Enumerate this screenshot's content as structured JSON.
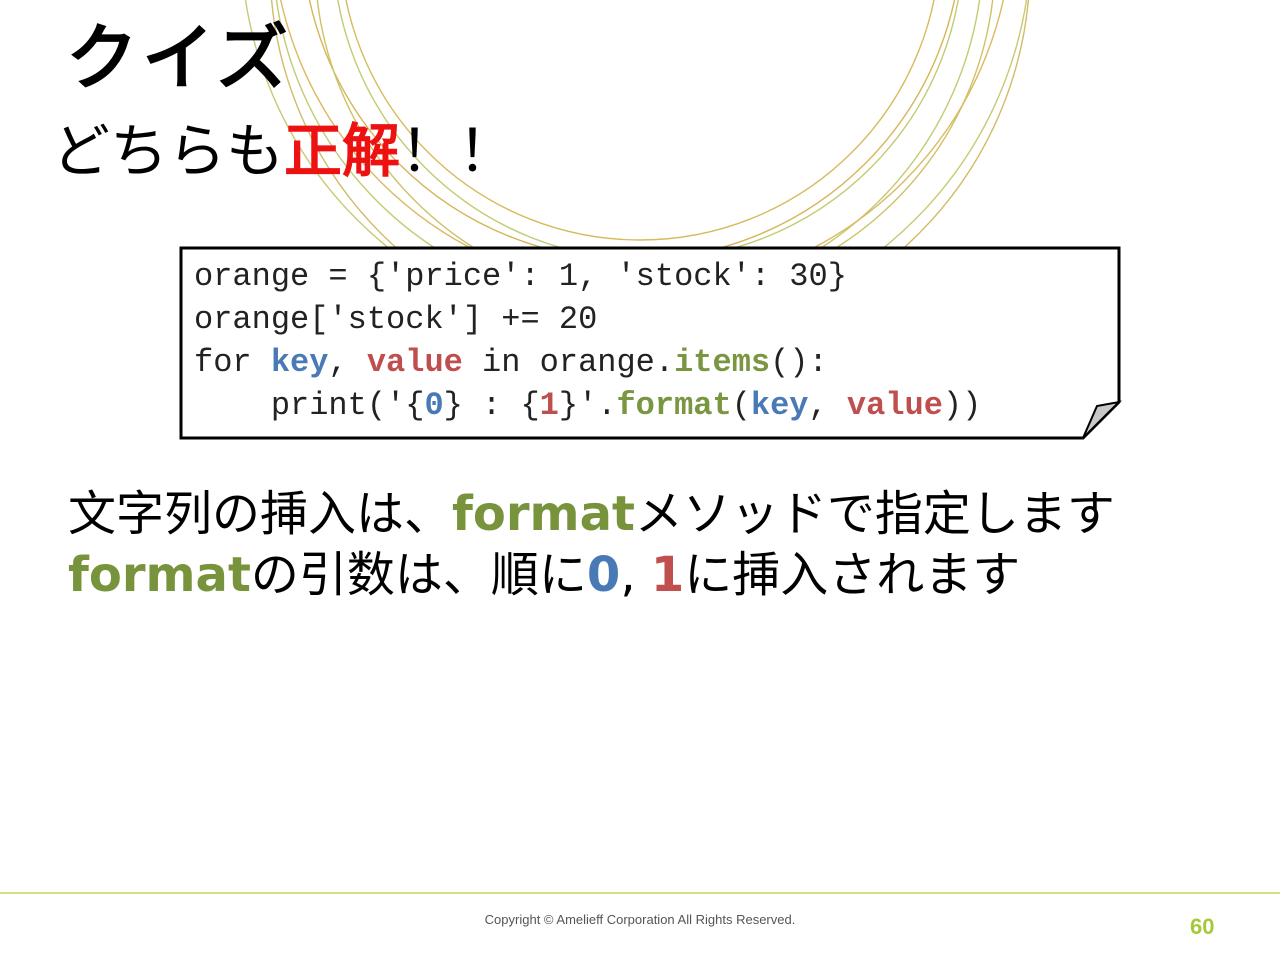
{
  "slide": {
    "title": "クイズ",
    "subtitle_prefix": "どちらも",
    "subtitle_emphasis": "正解",
    "subtitle_suffix": "！！"
  },
  "code": {
    "line1": "orange = {'price': 1, 'stock': 30}",
    "line2": "orange['stock'] += 20",
    "line3": {
      "t1": "for ",
      "key": "key",
      "t2": ", ",
      "value": "value",
      "t3": " in orange.",
      "items": "items",
      "t4": "():"
    },
    "line4": {
      "t1": "    print('{",
      "zero": "0",
      "t2": "} : {",
      "one": "1",
      "t3": "}'.",
      "format": "format",
      "t4": "(",
      "key": "key",
      "t5": ", ",
      "value": "value",
      "t6": "))"
    }
  },
  "description": {
    "line1": {
      "a": "文字列の挿入は、",
      "format": "format",
      "b": "メソッドで指定します"
    },
    "line2": {
      "format": "format",
      "a": "の引数は、順に",
      "zero": "0",
      "sep": ", ",
      "one": "1",
      "b": "に挿入されます"
    }
  },
  "footer": {
    "copyright": "Copyright © Amelieff Corporation All Rights Reserved.",
    "page_number": "60"
  },
  "colors": {
    "emphasis_red": "#ee1111",
    "code_blue": "#4a7ab5",
    "code_red": "#bf4f4f",
    "code_green": "#7a9640",
    "footer_line": "#d4e07a",
    "page_number": "#a7c83a",
    "deco_rings": "#c8b040"
  }
}
